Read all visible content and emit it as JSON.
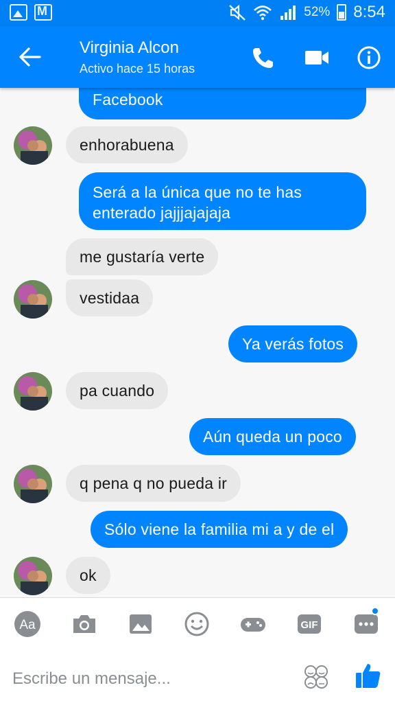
{
  "status_bar": {
    "battery": "52%",
    "time": "8:54"
  },
  "header": {
    "contact_name": "Virginia Alcon",
    "status": "Activo hace 15 horas"
  },
  "messages": [
    {
      "from": "me",
      "text": "Facebook"
    },
    {
      "from": "them",
      "text": "enhorabuena"
    },
    {
      "from": "me",
      "lines": [
        "Será a la única que no te has",
        "enterado jajjjajajaja"
      ]
    },
    {
      "from": "them",
      "text": "me gustaría verte"
    },
    {
      "from": "them",
      "text": "vestidaa"
    },
    {
      "from": "me",
      "text": "Ya verás fotos"
    },
    {
      "from": "them",
      "text": "pa cuando"
    },
    {
      "from": "me",
      "text": "Aún queda un poco"
    },
    {
      "from": "them",
      "text": "q pena q no pueda ir"
    },
    {
      "from": "me",
      "text": "Sólo viene la familia mi a y de el"
    },
    {
      "from": "them",
      "text": "ok"
    }
  ],
  "composer": {
    "toolbar": [
      "text-format-icon",
      "camera-icon",
      "gallery-icon",
      "emoji-icon",
      "game-icon",
      "gif-icon",
      "more-icon"
    ],
    "aa_label": "Aa",
    "gif_label": "GIF",
    "placeholder": "Escribe un mensaje..."
  },
  "colors": {
    "brand": "#0084ff",
    "incoming_bubble": "#e8e8e9",
    "icon_gray": "#8a8d91"
  }
}
